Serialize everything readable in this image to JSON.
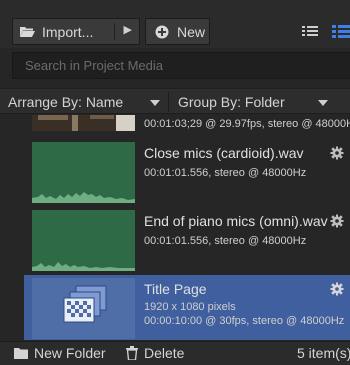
{
  "toolbar": {
    "import_label": "Import...",
    "new_label": "New"
  },
  "search": {
    "placeholder": "Search in Project Media"
  },
  "sortbar": {
    "arrange_label": "Arrange By: Name",
    "group_label": "Group By: Folder"
  },
  "items": [
    {
      "name": "",
      "meta_line1": "00:01:03;29 @ 29.97fps, stereo @ 48000Hz",
      "meta_line2": ""
    },
    {
      "name": "Close mics (cardioid).wav",
      "meta_line1": "00:01:01.556, stereo @ 48000Hz",
      "meta_line2": ""
    },
    {
      "name": "End of piano mics (omni).wav",
      "meta_line1": "00:01:01.556, stereo @ 48000Hz",
      "meta_line2": ""
    },
    {
      "name": "Title Page",
      "meta_line1": "1920 x 1080 pixels",
      "meta_line2": "00:00:10:00 @ 30fps, stereo @ 48000Hz"
    }
  ],
  "footer": {
    "new_folder_label": "New Folder",
    "delete_label": "Delete",
    "item_count": "5 item(s)"
  },
  "colors": {
    "selection": "#3f5f9e",
    "audio_thumb": "#2e6a45"
  }
}
